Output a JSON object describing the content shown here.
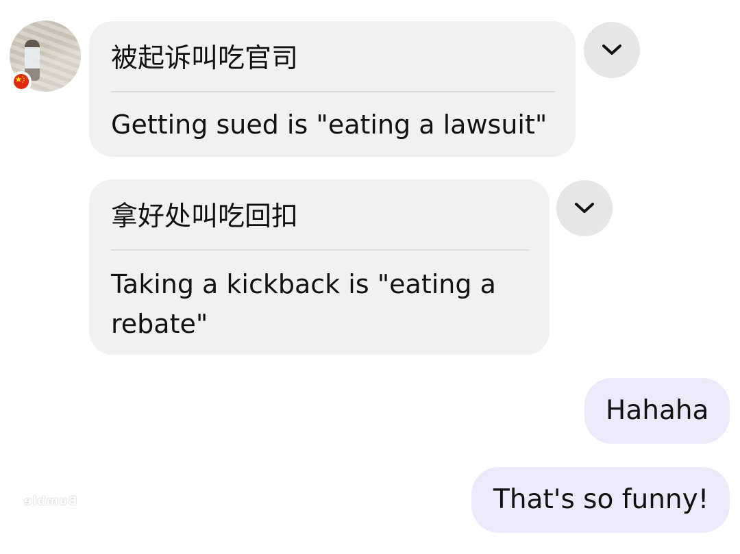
{
  "messages": [
    {
      "direction": "incoming",
      "original": "被起诉叫吃官司",
      "translation": "Getting sued is \"eating a lawsuit\"",
      "expand_icon": "chevron-down-icon"
    },
    {
      "direction": "incoming",
      "original": "拿好处叫吃回扣",
      "translation": "Taking a kickback is \"eating a rebate\"",
      "expand_icon": "chevron-down-icon"
    },
    {
      "direction": "outgoing",
      "text": "Hahaha"
    },
    {
      "direction": "outgoing",
      "text": "That's so funny!"
    }
  ],
  "sender": {
    "flag_icon": "china-flag-icon"
  },
  "watermark": "Bumble",
  "colors": {
    "incoming_bubble": "#f1f1f1",
    "outgoing_bubble": "#ece9fb",
    "chevron_button": "#e6e6e6",
    "flag_red": "#de2910",
    "flag_star": "#ffde00"
  }
}
